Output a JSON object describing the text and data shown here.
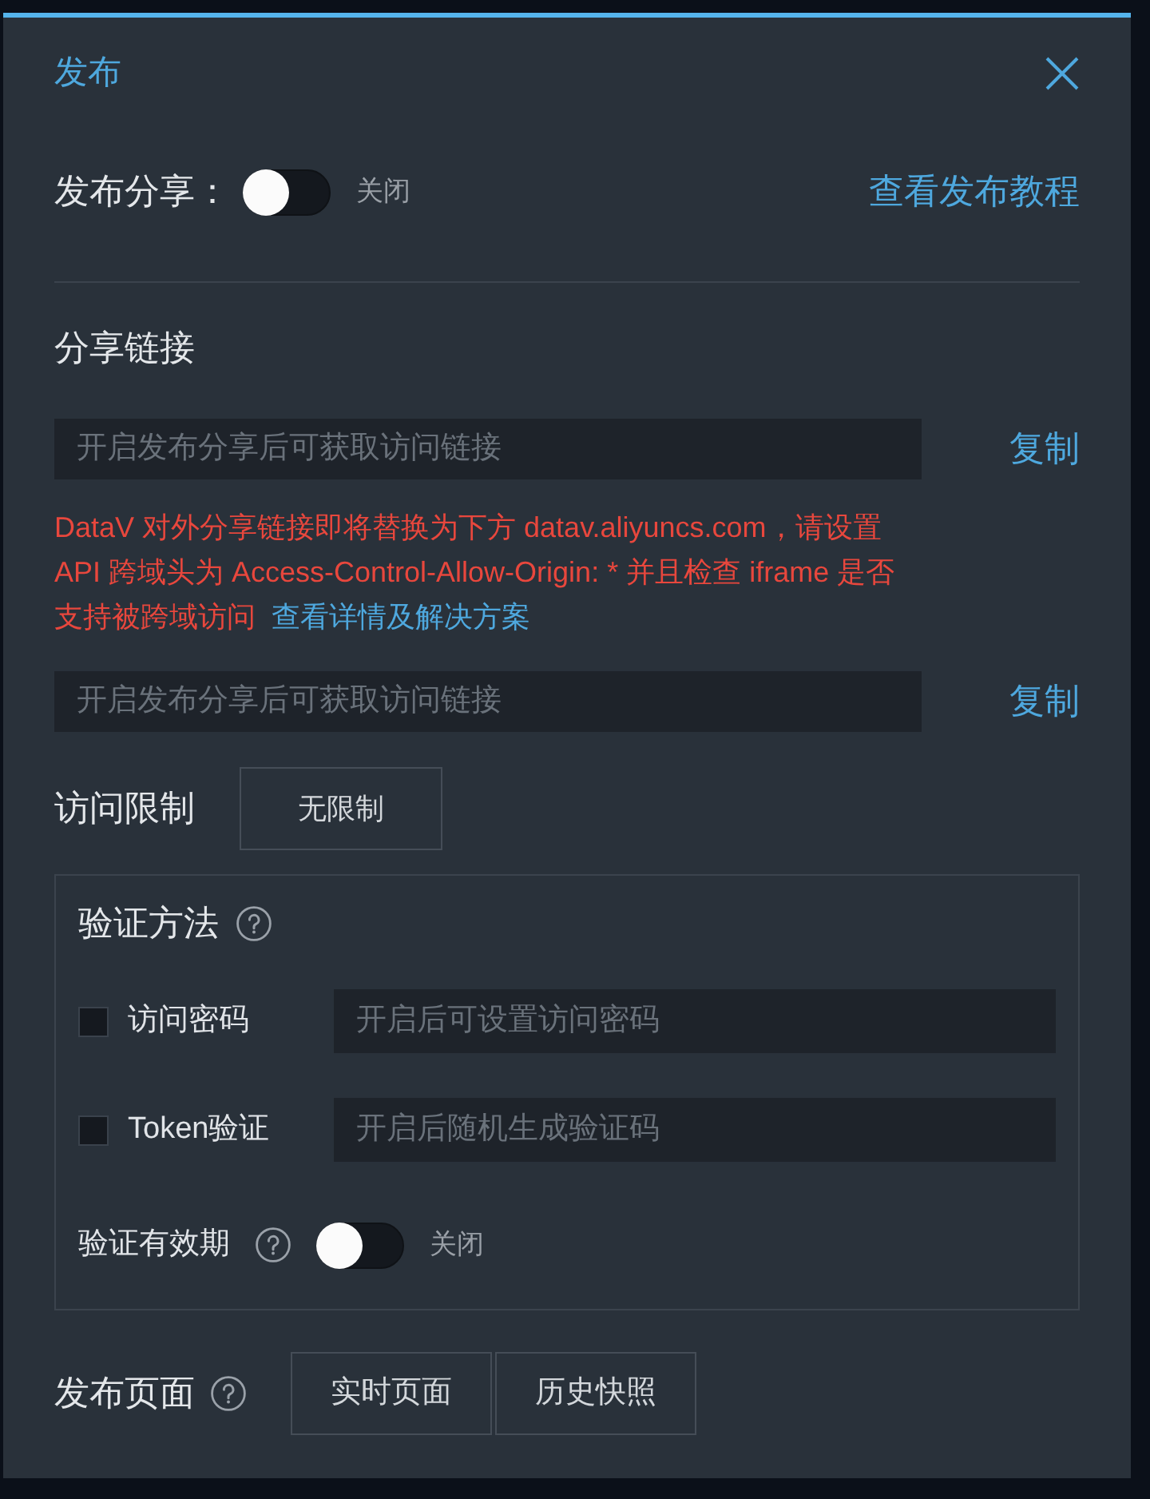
{
  "dialog": {
    "title": "发布"
  },
  "publish_share": {
    "label": "发布分享：",
    "on": false,
    "state_text": "关闭",
    "tutorial_link": "查看发布教程"
  },
  "share_link": {
    "heading": "分享链接",
    "items": [
      {
        "kind": "field",
        "placeholder": "开启发布分享后可获取访问链接",
        "copy_button": "复制"
      },
      {
        "kind": "notice",
        "text": "DataV 对外分享链接即将替换为下方 datav.aliyuncs.com，请设置 API 跨域头为 Access-Control-Allow-Origin: * 并且检查 iframe 是否支持被跨域访问",
        "link": "查看详情及解决方案"
      },
      {
        "kind": "field",
        "placeholder": "开启发布分享后可获取访问链接",
        "copy_button": "复制"
      }
    ]
  },
  "access_limit": {
    "label": "访问限制",
    "value": "无限制"
  },
  "verification": {
    "title": "验证方法",
    "methods": [
      {
        "label": "访问密码",
        "checked": false,
        "placeholder": "开启后可设置访问密码"
      },
      {
        "label": "Token验证",
        "checked": false,
        "placeholder": "开启后随机生成验证码"
      }
    ],
    "validity": {
      "label": "验证有效期",
      "on": false,
      "state_text": "关闭"
    }
  },
  "publish_page": {
    "label": "发布页面",
    "options": [
      {
        "label": "实时页面",
        "selected": false
      },
      {
        "label": "历史快照",
        "selected": false
      }
    ]
  }
}
